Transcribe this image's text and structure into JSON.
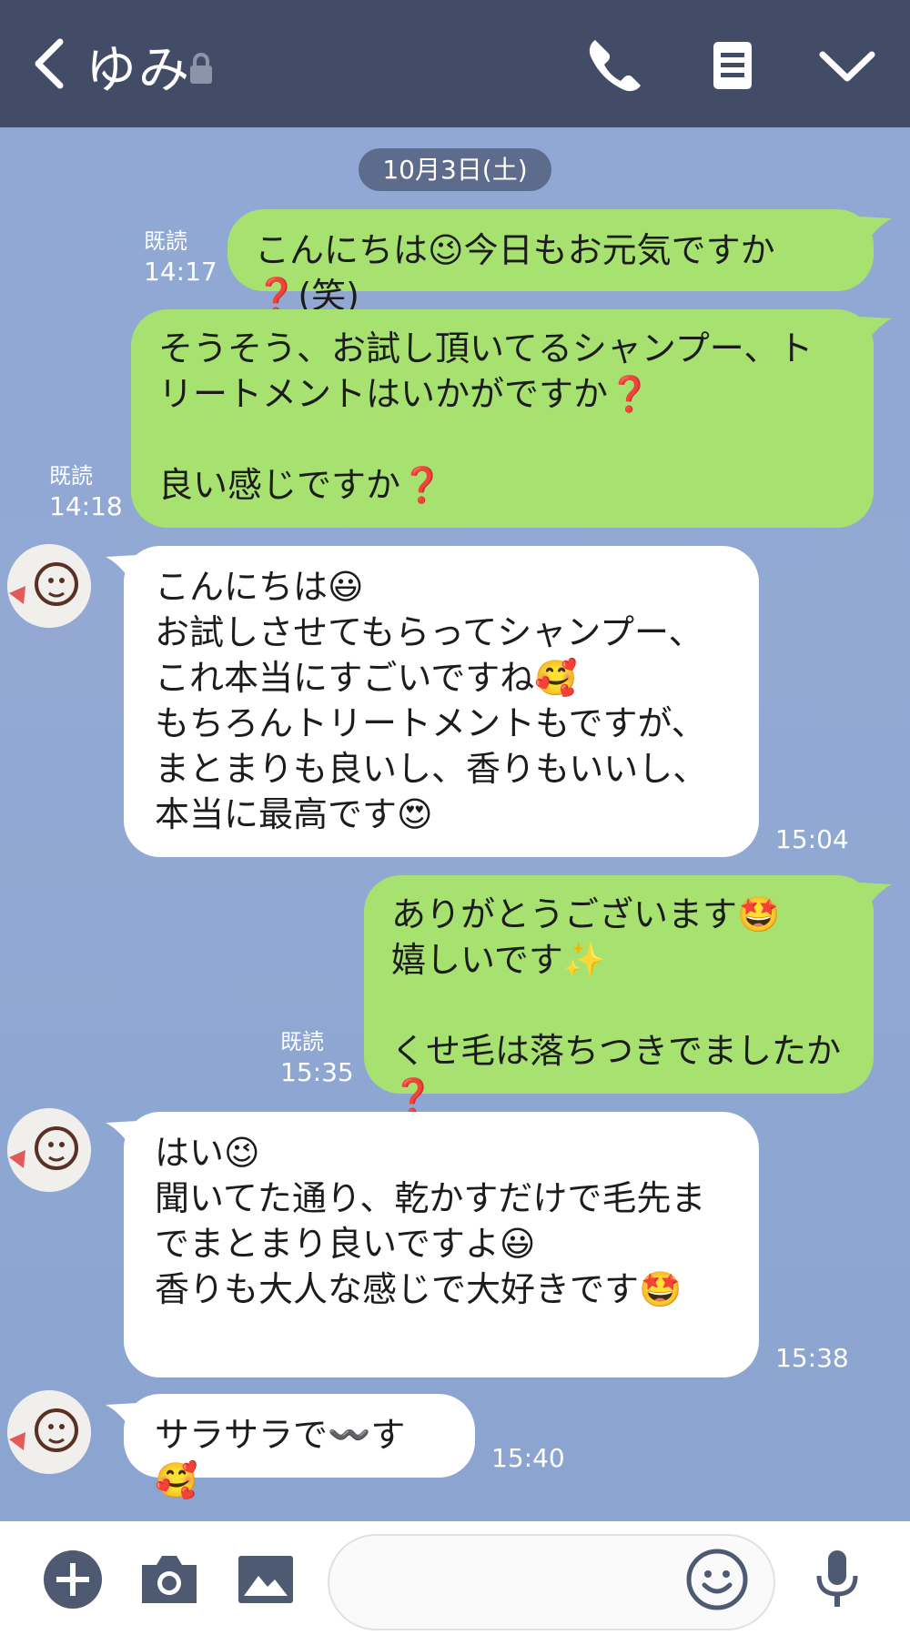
{
  "header": {
    "title": "ゆみ"
  },
  "date_label": "10月3日(土)",
  "messages": [
    {
      "side": "out",
      "text": "こんにちは😉今日もお元気ですか❓(笑)",
      "read": "既読",
      "time": "14:17"
    },
    {
      "side": "out",
      "text": "そうそう、お試し頂いてるシャンプー、トリートメントはいかがですか❓\n\n良い感じですか❓",
      "read": "既読",
      "time": "14:18"
    },
    {
      "side": "in",
      "text": "こんにちは😃\nお試しさせてもらってシャンプー、これ本当にすごいですね🥰\nもちろんトリートメントもですが、まとまりも良いし、香りもいいし、本当に最高です😍",
      "time": "15:04"
    },
    {
      "side": "out",
      "text": "ありがとうございます🤩\n嬉しいです✨\n\nくせ毛は落ちつきでましたか❓",
      "read": "既読",
      "time": "15:35"
    },
    {
      "side": "in",
      "text": "はい😉\n聞いてた通り、乾かすだけで毛先までまとまり良いですよ😃\n香りも大人な感じで大好きです🤩",
      "time": "15:38"
    },
    {
      "side": "in",
      "text": "サラサラで〰️す🥰",
      "time": "15:40"
    }
  ],
  "footer": {
    "input_value": "",
    "input_placeholder": ""
  },
  "icons": [
    "back-chevron-icon",
    "lock-icon",
    "phone-icon",
    "menu-icon",
    "chevron-down-icon",
    "plus-icon",
    "camera-icon",
    "image-icon",
    "emoji-icon",
    "microphone-icon"
  ],
  "colors": {
    "header": "#434c66",
    "outgoing_bubble": "#a7e271",
    "incoming_bubble": "#ffffff",
    "date_pill": "#5d6c8c"
  }
}
